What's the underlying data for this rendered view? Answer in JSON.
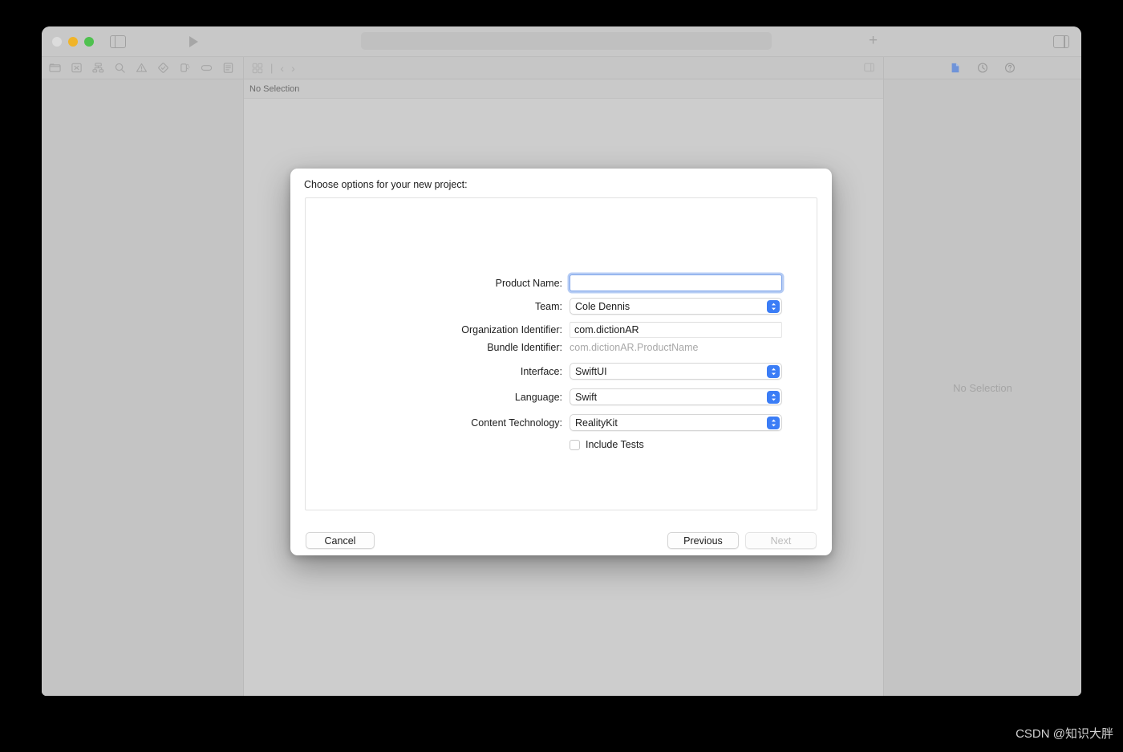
{
  "window": {
    "traffic_lights": [
      "close",
      "minimize",
      "zoom"
    ],
    "toolbar": {
      "sidebar_toggle_icon": "sidebar-left-icon",
      "run_icon": "run-play-icon",
      "activity_view_text": "",
      "add_icon": "plus-icon",
      "inspector_toggle_icon": "sidebar-right-icon"
    },
    "navigator": {
      "icons": [
        "folder-icon",
        "source-control-icon",
        "symbol-hierarchy-icon",
        "search-icon",
        "warning-triangle-icon",
        "test-diamond-icon",
        "debug-icon",
        "breakpoint-tag-icon",
        "report-icon"
      ]
    },
    "editor": {
      "jumpbar": {
        "grid_icon": "editor-grid-icon",
        "separator": "|",
        "back_chevron": "chevron-left-icon",
        "forward_chevron": "chevron-right-icon",
        "right_icon": "editor-options-icon"
      },
      "no_selection_label": "No Selection"
    },
    "inspector": {
      "icons": [
        "file-inspector-icon",
        "history-inspector-icon",
        "quick-help-icon"
      ],
      "selected_icon": "file-inspector-icon",
      "accent_color": "#6f93d8",
      "empty_label": "No Selection"
    },
    "statusbar": {
      "filter_icon": "filter-chip-icon",
      "right_icon": "device-icon"
    }
  },
  "dialog": {
    "title": "Choose options for your new project:",
    "fields": [
      {
        "label": "Product Name:",
        "kind": "textfield-focused",
        "value": "",
        "placeholder": "",
        "name": "product-name"
      },
      {
        "label": "Team:",
        "kind": "popup",
        "value": "Cole Dennis",
        "name": "team"
      },
      {
        "label": "Organization Identifier:",
        "kind": "textfield",
        "value": "com.dictionAR",
        "placeholder": "",
        "name": "organization-identifier"
      },
      {
        "label": "Bundle Identifier:",
        "kind": "static",
        "value": "com.dictionAR.ProductName",
        "name": "bundle-identifier"
      },
      {
        "label": "Interface:",
        "kind": "popup",
        "value": "SwiftUI",
        "name": "interface"
      },
      {
        "label": "Language:",
        "kind": "popup",
        "value": "Swift",
        "name": "language"
      },
      {
        "label": "Content Technology:",
        "kind": "popup",
        "value": "RealityKit",
        "name": "content-technology"
      }
    ],
    "checkbox": {
      "label": "Include Tests",
      "checked": false
    },
    "buttons": {
      "cancel": "Cancel",
      "previous": "Previous",
      "next": "Next",
      "next_disabled": true
    },
    "accent_color": "#3b7df6"
  },
  "watermark": "CSDN @知识大胖"
}
